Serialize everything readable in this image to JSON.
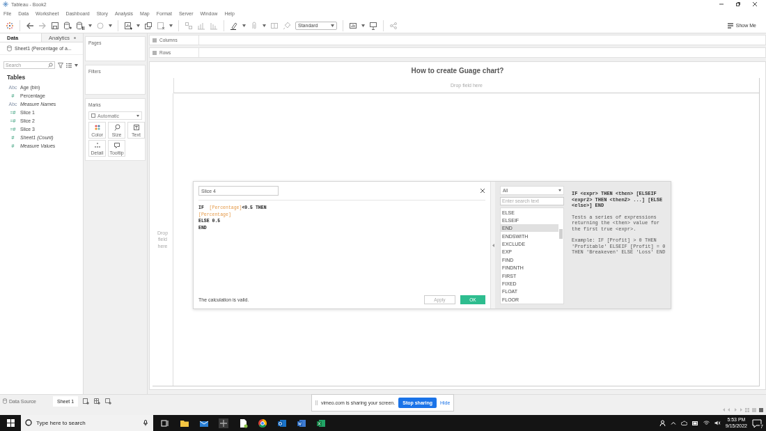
{
  "window": {
    "title": "Tableau - Book2"
  },
  "menu": [
    "File",
    "Data",
    "Worksheet",
    "Dashboard",
    "Story",
    "Analysis",
    "Map",
    "Format",
    "Server",
    "Window",
    "Help"
  ],
  "toolbar": {
    "fit": "Standard",
    "show_me": "Show Me"
  },
  "data_pane": {
    "tabs": [
      {
        "label": "Data",
        "selected": true
      },
      {
        "label": "Analytics",
        "selected": false
      }
    ],
    "source": "Sheet1 (Percentage of a...",
    "search": {
      "placeholder": "Search"
    },
    "section": "Tables",
    "fields": [
      {
        "icon": "Abc",
        "kind": "dimension",
        "name": "Age (bin)",
        "italic": false
      },
      {
        "icon": "#",
        "kind": "measure",
        "name": "Percentage",
        "italic": false
      },
      {
        "icon": "Abc",
        "kind": "dimension",
        "name": "Measure Names",
        "italic": true
      },
      {
        "icon": "=#",
        "kind": "measure",
        "name": "Slice 1",
        "italic": false
      },
      {
        "icon": "=#",
        "kind": "measure",
        "name": "Slice 2",
        "italic": false
      },
      {
        "icon": "=#",
        "kind": "measure",
        "name": "Slice 3",
        "italic": false
      },
      {
        "icon": "#",
        "kind": "measure",
        "name": "Sheet1 (Count)",
        "italic": true
      },
      {
        "icon": "#",
        "kind": "measure",
        "name": "Measure Values",
        "italic": true
      }
    ]
  },
  "shelves": {
    "pages": "Pages",
    "filters": "Filters",
    "columns": "Columns",
    "rows": "Rows",
    "marks": {
      "title": "Marks",
      "type": "Automatic",
      "buttons": [
        {
          "label": "Color",
          "kind": "color"
        },
        {
          "label": "Size",
          "kind": "size"
        },
        {
          "label": "Text",
          "kind": "text"
        },
        {
          "label": "Detail",
          "kind": "detail"
        },
        {
          "label": "Tooltip",
          "kind": "tooltip"
        }
      ]
    }
  },
  "view": {
    "title": "How to create Guage chart?",
    "drop_top": "Drop field here",
    "drop_left": "Drop field here"
  },
  "calc_dialog": {
    "name": "Slice 4",
    "code": [
      {
        "tokens": [
          {
            "kind": "keyword",
            "text": "IF  "
          },
          {
            "kind": "field",
            "text": "[Percentage]"
          },
          {
            "kind": "keyword",
            "text": "<0.5 THEN"
          }
        ]
      },
      {
        "tokens": [
          {
            "kind": "field",
            "text": "[Percentage]"
          }
        ]
      },
      {
        "tokens": [
          {
            "kind": "keyword",
            "text": "ELSE 0.5"
          }
        ]
      },
      {
        "tokens": [
          {
            "kind": "keyword",
            "text": "END"
          }
        ]
      }
    ],
    "status": "The calculation is valid.",
    "apply": {
      "label": "Apply",
      "disabled": true
    },
    "ok": "OK",
    "functions": {
      "category": "All",
      "search": {
        "placeholder": "Enter search text"
      },
      "items": [
        {
          "label": "ELSE",
          "selected": false
        },
        {
          "label": "ELSEIF",
          "selected": false
        },
        {
          "label": "END",
          "selected": true
        },
        {
          "label": "ENDSWITH",
          "selected": false
        },
        {
          "label": "EXCLUDE",
          "selected": false
        },
        {
          "label": "EXP",
          "selected": false
        },
        {
          "label": "FIND",
          "selected": false
        },
        {
          "label": "FINDNTH",
          "selected": false
        },
        {
          "label": "FIRST",
          "selected": false
        },
        {
          "label": "FIXED",
          "selected": false
        },
        {
          "label": "FLOAT",
          "selected": false
        },
        {
          "label": "FLOOR",
          "selected": false
        }
      ]
    },
    "help": [
      "IF <expr> THEN <then> [ELSEIF <expr2> THEN <then2> ...] [ELSE <else>] END",
      "Tests a series of expressions returning the <then> value for the first true <expr>.",
      "Example: IF [Profit] > 0 THEN 'Profitable' ELSEIF [Profit] = 0 THEN 'Breakeven' ELSE 'Loss' END"
    ]
  },
  "sheet_tabs": {
    "data_source": "Data Source",
    "sheets": [
      {
        "label": "Sheet 1",
        "selected": true
      }
    ]
  },
  "share_bar": {
    "message": "vimeo.com is sharing your screen.",
    "stop": "Stop sharing",
    "hide": "Hide"
  },
  "taskbar": {
    "search": {
      "placeholder": "Type here to search"
    },
    "time": "5:53 PM",
    "date": "9/15/2022",
    "notifications": "7"
  }
}
